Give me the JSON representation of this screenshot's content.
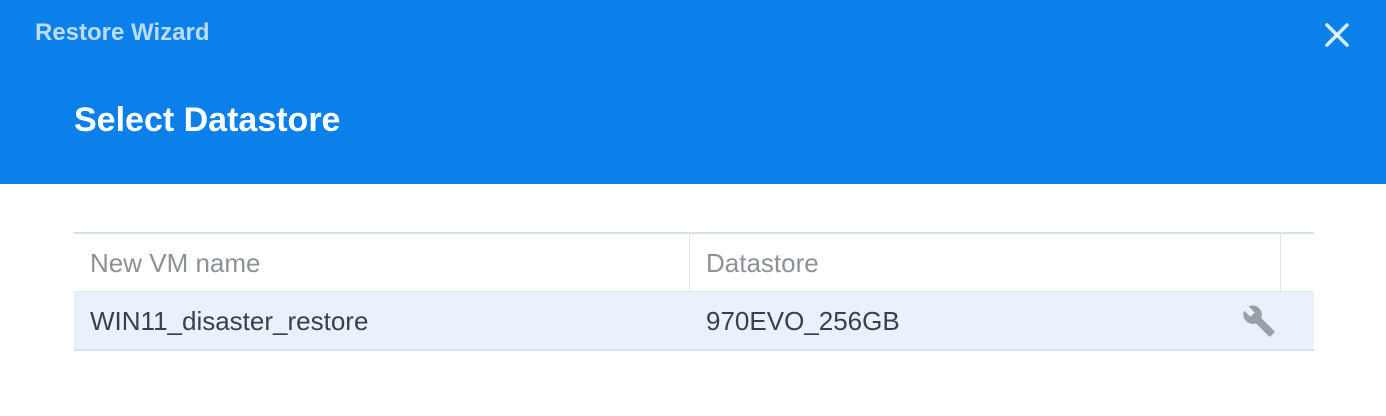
{
  "window": {
    "title": "Restore Wizard",
    "close_icon": "close-icon"
  },
  "step": {
    "title": "Select Datastore"
  },
  "table": {
    "columns": [
      "New VM name",
      "Datastore"
    ],
    "rows": [
      {
        "vm_name": "WIN11_disaster_restore",
        "datastore": "970EVO_256GB",
        "action_icon": "wrench-icon"
      }
    ]
  },
  "colors": {
    "header_bg": "#0b80ea",
    "row_selected_bg": "#e9f2fc",
    "header_text": "#ffffff",
    "column_header_text": "#8c9196",
    "cell_text": "#3b4047",
    "icon_gray": "#9aa0a6"
  }
}
